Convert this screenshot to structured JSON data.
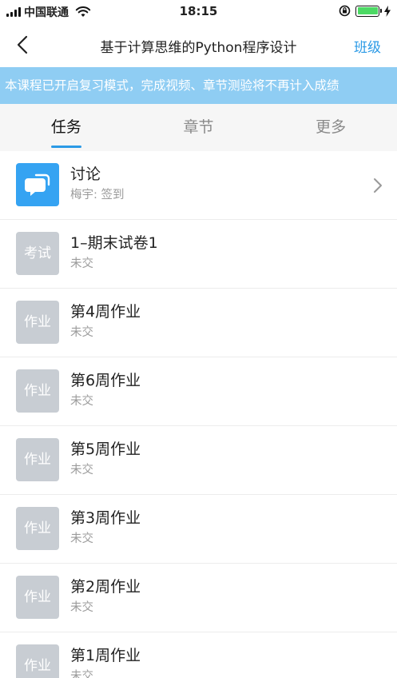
{
  "status_bar": {
    "carrier": "中国联通",
    "time": "18:15"
  },
  "nav": {
    "title": "基于计算思维的Python程序设计",
    "action": "班级"
  },
  "banner": {
    "text": "本课程已开启复习模式，完成视频、章节测验将不再计入成绩"
  },
  "tabs": [
    {
      "label": "任务",
      "active": true
    },
    {
      "label": "章节",
      "active": false
    },
    {
      "label": "更多",
      "active": false
    }
  ],
  "items": [
    {
      "badge": "",
      "icon": "chat-bubble-icon",
      "title": "讨论",
      "sub": "梅宇: 签到"
    },
    {
      "badge": "考试",
      "title": "1–期末试卷1",
      "sub": "未交"
    },
    {
      "badge": "作业",
      "title": "第4周作业",
      "sub": "未交"
    },
    {
      "badge": "作业",
      "title": "第6周作业",
      "sub": "未交"
    },
    {
      "badge": "作业",
      "title": "第5周作业",
      "sub": "未交"
    },
    {
      "badge": "作业",
      "title": "第3周作业",
      "sub": "未交"
    },
    {
      "badge": "作业",
      "title": "第2周作业",
      "sub": "未交"
    },
    {
      "badge": "作业",
      "title": "第1周作业",
      "sub": "未交"
    }
  ],
  "colors": {
    "accent": "#2b9ae6",
    "banner": "#8fcdf3",
    "badge_gray": "#c8cdd3",
    "badge_blue": "#35a3f2"
  }
}
